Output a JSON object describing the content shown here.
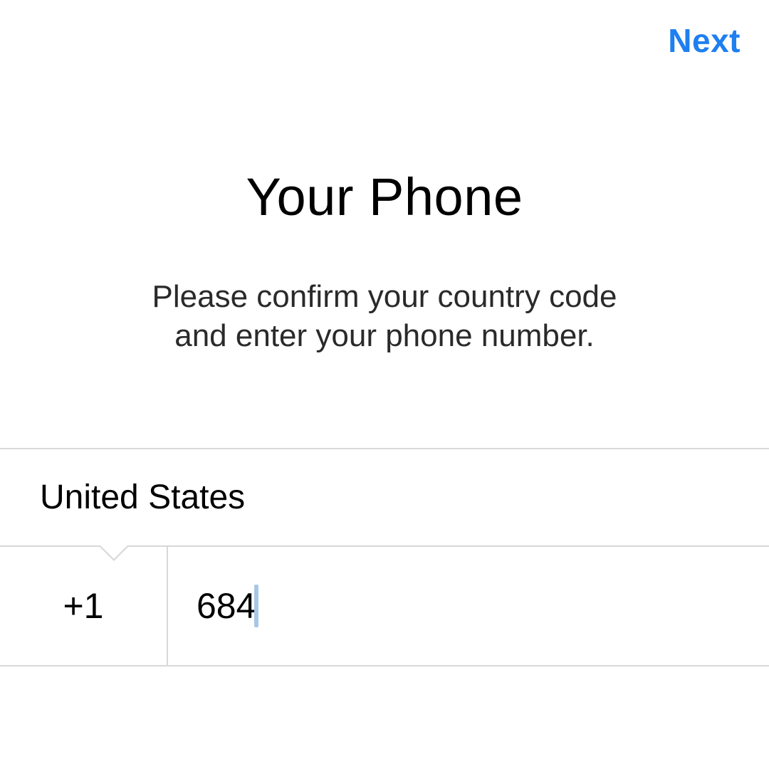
{
  "header": {
    "next_label": "Next"
  },
  "title": "Your Phone",
  "subtitle_line1": "Please confirm your country code",
  "subtitle_line2": "and enter your phone number.",
  "form": {
    "selected_country": "United States",
    "country_code": "+1",
    "phone_value": "684"
  },
  "colors": {
    "accent": "#1e7ff0",
    "divider": "#d8d8d8",
    "caret": "#a7c7e7"
  }
}
